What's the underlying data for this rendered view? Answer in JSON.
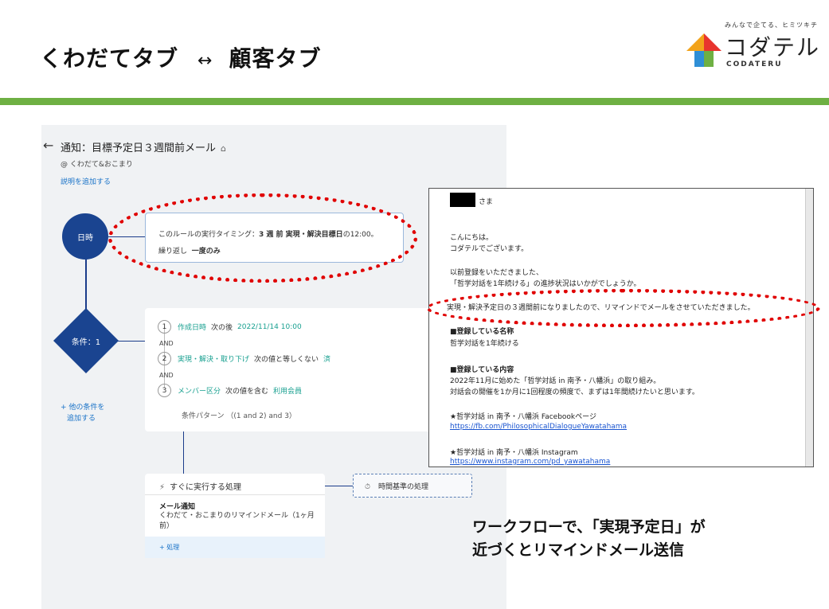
{
  "slide": {
    "title_left": "くわだてタブ",
    "arrow": "↔",
    "title_right": "顧客タブ"
  },
  "logo": {
    "tagline": "みんなで企てる、ヒミツキチ",
    "name": "コダテル",
    "sub": "CODATERU"
  },
  "colors": {
    "accent_green": "#6eb043",
    "node_blue": "#1a4490",
    "highlight_red": "#e00000",
    "link_blue": "#1a73c8",
    "teal": "#18a090"
  },
  "workflow": {
    "back_icon": "←",
    "title": "通知：目標予定日３週間前メール",
    "lock_icon": "⌂",
    "owner": "@ くわだて&おこまり",
    "add_description": "説明を追加する",
    "trigger_node": "日時",
    "timing_card": {
      "prefix": "このルールの実行タイミング：",
      "bold": "3 週 前 実現・解決目標日",
      "suffix": "の12:00。",
      "repeat_label": "繰り返し",
      "repeat_value": "一度のみ"
    },
    "condition_node": "条件：1",
    "conditions": [
      {
        "num": "1",
        "field": "作成日時",
        "op": "次の後",
        "value": "2022/11/14 10:00"
      },
      {
        "num": "2",
        "field": "実現・解決・取り下げ",
        "op": "次の値と等しくない",
        "value": "済"
      },
      {
        "num": "3",
        "field": "メンバー区分",
        "op": "次の値を含む",
        "value": "利用会員"
      }
    ],
    "and_label": "AND",
    "pattern": "条件パターン （(1 and 2) and 3）",
    "add_condition_line1": "+ 他の条件を",
    "add_condition_line2": "追加する",
    "action_card": {
      "title": "すぐに実行する処理",
      "heading": "メール通知",
      "text": "くわだて・おこまりのリマインドメール（1ヶ月前）",
      "add": "+ 処理"
    },
    "time_based": "時間基準の処理"
  },
  "email": {
    "salutation": "さま",
    "lines": [
      "こんにちは。",
      "コダテルでございます。",
      "以前登録をいただきました、",
      "「哲学対話を1年続ける」の進捗状況はいかがでしょうか。",
      "実現・解決予定日の３週間前になりましたので、リマインドでメールをさせていただきました。",
      "■登録している名称",
      "哲学対話を1年続ける",
      "■登録している内容",
      "2022年11月に始めた「哲学対話 in 南予・八幡浜」の取り組み。",
      "対話会の開催を1か月に1回程度の頻度で、まずは1年間続けたいと思います。",
      "★哲学対話 in 南予・八幡浜 Facebookページ",
      "https://fb.com/PhilosophicalDialogueYawatahama",
      "★哲学対話 in 南予・八幡浜 Instagram",
      "https://www.instagram.com/pd_yawatahama"
    ]
  },
  "caption": {
    "line1": "ワークフローで、「実現予定日」が",
    "line2": "近づくとリマインドメール送信"
  }
}
